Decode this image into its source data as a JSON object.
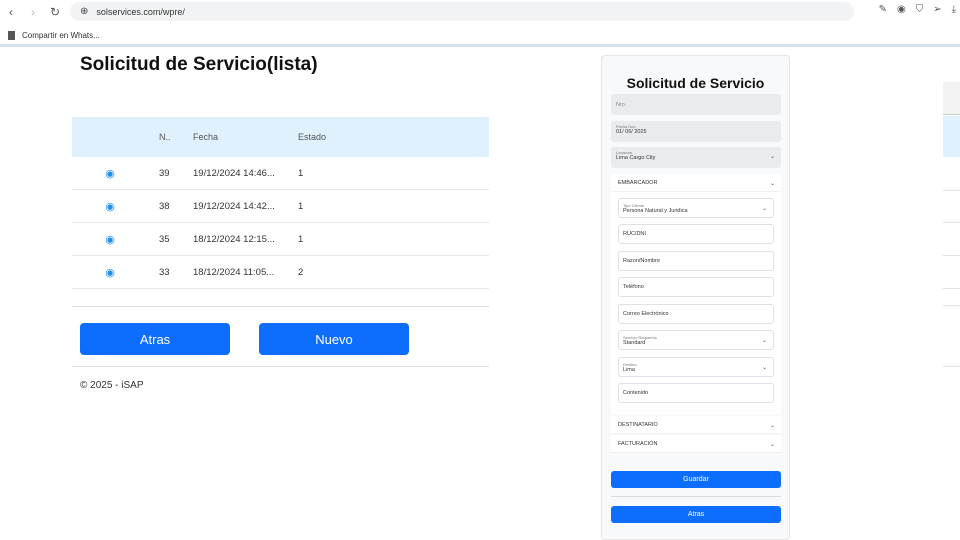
{
  "browser": {
    "url": "solservices.com/wpre/",
    "bookmark": "Compartir en Whats..."
  },
  "page": {
    "title": "Solicitud de Servicio(lista)",
    "footer": "© 2025 - iSAP",
    "back": "Atras",
    "new": "Nuevo"
  },
  "table": {
    "headers": [
      "N..",
      "Fecha",
      "Estado"
    ],
    "rows": [
      {
        "n": "39",
        "fecha": "19/12/2024 14:46...",
        "estado": "1"
      },
      {
        "n": "38",
        "fecha": "19/12/2024 14:42...",
        "estado": "1"
      },
      {
        "n": "35",
        "fecha": "18/12/2024 12:15...",
        "estado": "1"
      },
      {
        "n": "33",
        "fecha": "18/12/2024 11:05...",
        "estado": "2"
      }
    ]
  },
  "form": {
    "title": "Solicitud de Servicio",
    "nro": "Nro.",
    "fecha_label": "Fecha Doc.",
    "fecha": "01/ 06/ 2025",
    "loc_label": "Locacion",
    "loc": "Lima Cargo City",
    "embarcador": "EMBARCADOR",
    "tipo_label": "Tipo Cliente",
    "tipo": "Persona Natural y Juridica",
    "ruc": "RUC/DNI",
    "razon": "Razon/Nombre",
    "telefono": "Teléfono",
    "correo": "Correo Electrónico",
    "serv_label": "Servicio Requerido",
    "serv": "Standard",
    "dest_label": "Destino",
    "dest": "Lima",
    "contenido": "Contenido",
    "destinatario": "DESTINATARIO",
    "facturacion": "FACTURACIÓN",
    "guardar": "Guardar",
    "atras": "Atras"
  }
}
